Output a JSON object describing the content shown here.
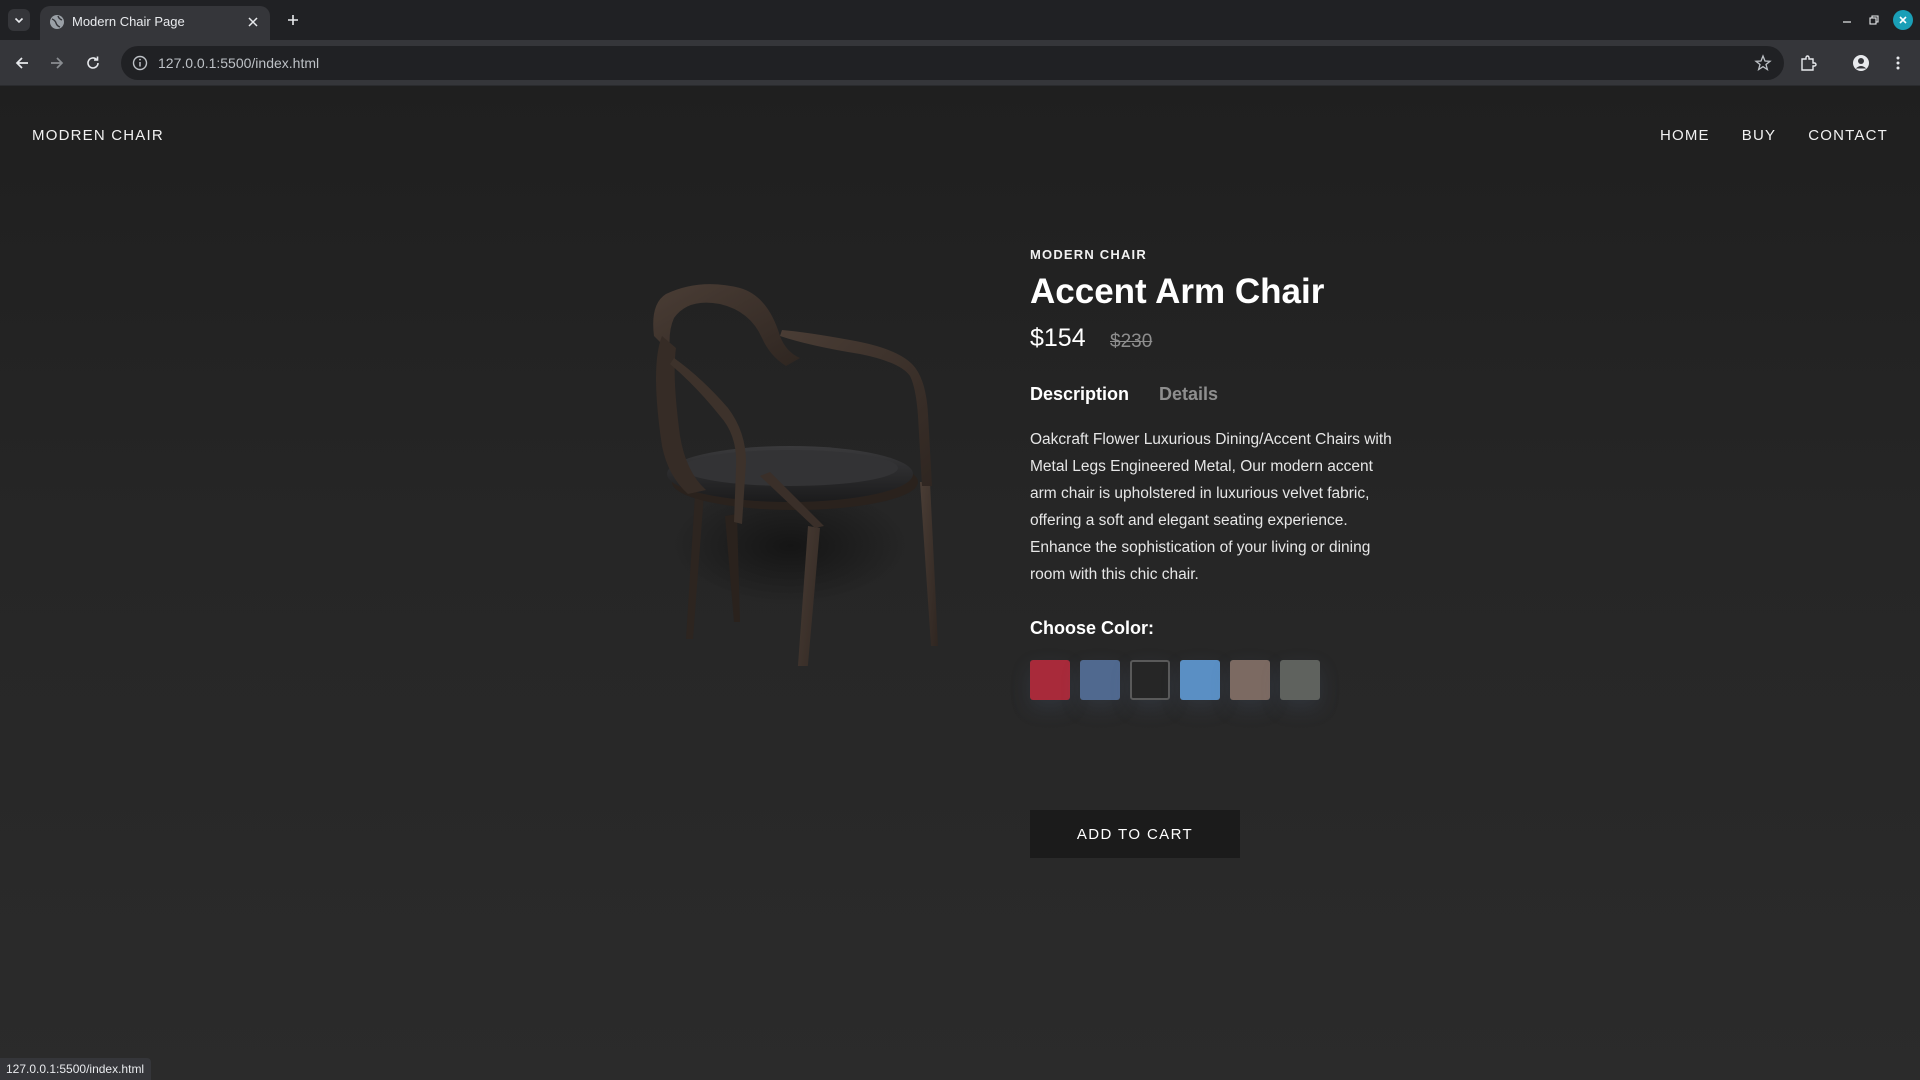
{
  "browser": {
    "tab_title": "Modern Chair Page",
    "url": "127.0.0.1:5500/index.html",
    "status_url": "127.0.0.1:5500/index.html"
  },
  "header": {
    "logo": "MODREN CHAIR",
    "nav": [
      "HOME",
      "BUY",
      "CONTACT"
    ]
  },
  "product": {
    "eyebrow": "MODERN CHAIR",
    "title": "Accent Arm Chair",
    "price": "$154",
    "old_price": "$230",
    "tabs": [
      "Description",
      "Details"
    ],
    "active_tab": "Description",
    "description": "Oakcraft Flower Luxurious Dining/Accent Chairs with Metal Legs Engineered Metal, Our modern accent arm chair is upholstered in luxurious velvet fabric, offering a soft and elegant seating experience. Enhance the sophistication of your living or dining room with this chic chair.",
    "choose_color_label": "Choose Color:",
    "colors": [
      {
        "name": "red",
        "hex": "#a82a3a"
      },
      {
        "name": "denim-blue",
        "hex": "#50698f"
      },
      {
        "name": "black",
        "hex": "#262626"
      },
      {
        "name": "sky-blue",
        "hex": "#5a8fc4"
      },
      {
        "name": "taupe",
        "hex": "#7c6a62"
      },
      {
        "name": "grey-green",
        "hex": "#5f625e"
      }
    ],
    "selected_color": "black",
    "add_to_cart_label": "ADD TO CART"
  }
}
